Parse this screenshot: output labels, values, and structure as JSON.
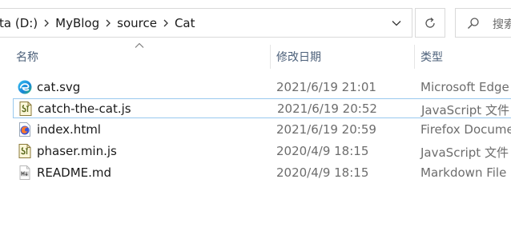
{
  "address_bar": {
    "crumbs": [
      "ta (D:)",
      "MyBlog",
      "source",
      "Cat"
    ]
  },
  "search": {
    "placeholder": "搜索\""
  },
  "columns": {
    "name": "名称",
    "date_modified": "修改日期",
    "type": "类型"
  },
  "files": [
    {
      "name": "cat.svg",
      "date": "2021/6/19 21:01",
      "type": "Microsoft Edge",
      "icon": "edge-icon"
    },
    {
      "name": "catch-the-cat.js",
      "date": "2021/6/19 20:52",
      "type": "JavaScript 文件",
      "icon": "javascript-file-icon"
    },
    {
      "name": "index.html",
      "date": "2021/6/19 20:59",
      "type": "Firefox Docume",
      "icon": "firefox-document-icon"
    },
    {
      "name": "phaser.min.js",
      "date": "2020/4/9 18:15",
      "type": "JavaScript 文件",
      "icon": "javascript-file-icon"
    },
    {
      "name": "README.md",
      "date": "2020/4/9 18:15",
      "type": "Markdown File",
      "icon": "markdown-file-icon"
    }
  ],
  "colors": {
    "header_text": "#4c607a",
    "focus_border": "#99c9ef",
    "secondary_text": "#6d6d6d"
  }
}
